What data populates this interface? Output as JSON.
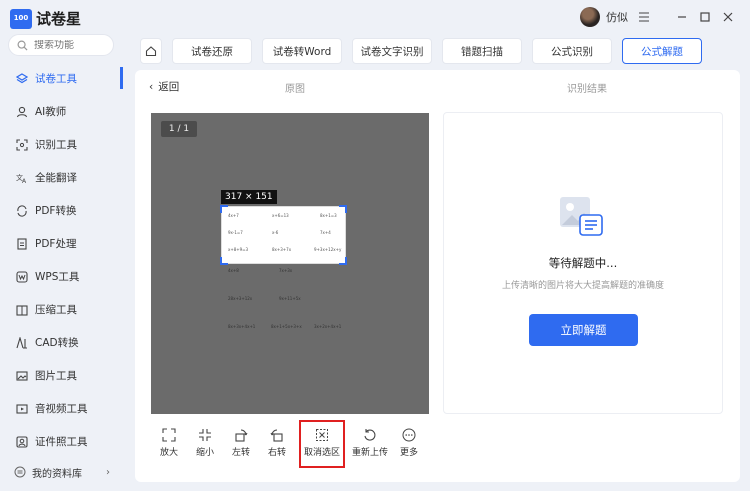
{
  "app": {
    "logo_badge": "100 试卷宝",
    "name": "试卷星",
    "search_placeholder": "搜索功能",
    "accent": "#2f6bf0"
  },
  "sidebar": {
    "items": [
      {
        "label": "试卷工具",
        "icon": "layers-icon",
        "active": true
      },
      {
        "label": "AI教师",
        "icon": "ai-teacher-icon"
      },
      {
        "label": "识别工具",
        "icon": "scan-icon"
      },
      {
        "label": "全能翻译",
        "icon": "translate-icon"
      },
      {
        "label": "PDF转换",
        "icon": "convert-icon"
      },
      {
        "label": "PDF处理",
        "icon": "pdf-icon"
      },
      {
        "label": "WPS工具",
        "icon": "wps-icon"
      },
      {
        "label": "压缩工具",
        "icon": "compress-icon"
      },
      {
        "label": "CAD转换",
        "icon": "cad-icon"
      },
      {
        "label": "图片工具",
        "icon": "image-icon"
      },
      {
        "label": "音视频工具",
        "icon": "video-icon"
      },
      {
        "label": "证件照工具",
        "icon": "id-photo-icon"
      }
    ],
    "library_label": "我的资料库"
  },
  "titlebar": {
    "username": "仿似"
  },
  "tabs": [
    {
      "label": "试卷还原",
      "active": false
    },
    {
      "label": "试卷转Word",
      "active": false
    },
    {
      "label": "试卷文字识别",
      "active": false
    },
    {
      "label": "错题扫描",
      "active": false
    },
    {
      "label": "公式识别",
      "active": false
    },
    {
      "label": "公式解题",
      "active": true
    }
  ],
  "main": {
    "back_label": "返回",
    "original_header": "原图",
    "result_header": "识别结果",
    "page_counter": "1 / 1",
    "selection_size": "317 × 151",
    "math_rows": [
      [
        "4x+7",
        "x+6=13",
        "8x+1=3"
      ],
      [
        "9x-1=7",
        "x-6",
        "7x+4"
      ],
      [
        "x+8+9=3",
        "8x+3+7x",
        "9+3x+12x+y"
      ]
    ],
    "math_rows_below": [
      [
        "4x+8",
        "7x+3x",
        ""
      ],
      [
        "28x+3+12x",
        "9x+11+5x",
        ""
      ],
      [
        "8x+3x+4x+1",
        "8x+1+5x+3+x",
        "3x+2x+4x+1"
      ]
    ]
  },
  "toolbar": [
    {
      "label": "放大",
      "icon": "zoom-in-icon"
    },
    {
      "label": "缩小",
      "icon": "zoom-out-icon"
    },
    {
      "label": "左转",
      "icon": "rotate-left-icon"
    },
    {
      "label": "右转",
      "icon": "rotate-right-icon"
    },
    {
      "label": "取消选区",
      "icon": "cancel-selection-icon",
      "highlighted": true
    },
    {
      "label": "重新上传",
      "icon": "reupload-icon"
    },
    {
      "label": "更多",
      "icon": "more-icon"
    }
  ],
  "result": {
    "waiting_text": "等待解题中...",
    "hint_text": "上传清晰的图片将大大提高解题的准确度",
    "solve_button": "立即解题"
  }
}
